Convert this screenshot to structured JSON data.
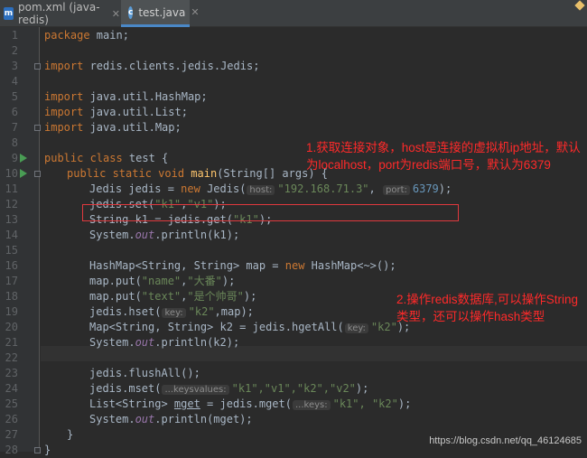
{
  "tabs": [
    {
      "label": "pom.xml (java-redis)",
      "icon": "maven-m-icon",
      "close": "✕"
    },
    {
      "label": "test.java",
      "icon": "go-class-icon",
      "close": "✕"
    }
  ],
  "line_numbers": [
    "1",
    "2",
    "3",
    "4",
    "5",
    "6",
    "7",
    "8",
    "9",
    "10",
    "11",
    "12",
    "13",
    "14",
    "15",
    "16",
    "17",
    "18",
    "19",
    "20",
    "21",
    "22",
    "23",
    "24",
    "25",
    "26",
    "27",
    "28"
  ],
  "code": {
    "l1_kw": "package",
    "l1_rest": " main;",
    "l3_kw": "import",
    "l3_rest": " redis.clients.jedis.Jedis;",
    "l5_kw": "import",
    "l5_rest": " java.util.HashMap;",
    "l6_kw": "import",
    "l6_rest": " java.util.List;",
    "l7_kw": "import",
    "l7_rest": " java.util.Map;",
    "l9_kw": "public class",
    "l9_rest": " test {",
    "l10_kw": "public static void",
    "l10_fn": "main",
    "l10_rest": "(String[] args) {",
    "l11_a": "Jedis jedis = ",
    "l11_new": "new",
    "l11_b": " Jedis(",
    "l11_hint1": "host:",
    "l11_str": "\"192.168.71.3\"",
    "l11_c": ", ",
    "l11_hint2": "port:",
    "l11_num": "6379",
    "l11_d": ");",
    "l12_a": "jedis.set(",
    "l12_s1": "\"k1\"",
    "l12_b": ",",
    "l12_s2": "\"v1\"",
    "l12_c": ");",
    "l13_a": "String k1 = jedis.get(",
    "l13_s1": "\"k1\"",
    "l13_b": ");",
    "l14_a": "System.",
    "l14_out": "out",
    "l14_b": ".println(k1);",
    "l16_a": "HashMap<String, String> map = ",
    "l16_new": "new",
    "l16_b": " HashMap<~>();",
    "l17_a": "map.put(",
    "l17_s1": "\"name\"",
    "l17_b": ",",
    "l17_s2": "\"大番\"",
    "l17_c": ");",
    "l18_a": "map.put(",
    "l18_s1": "\"text\"",
    "l18_b": ",",
    "l18_s2": "\"是个帅哥\"",
    "l18_c": ");",
    "l19_a": "jedis.hset(",
    "l19_hint": "key:",
    "l19_s1": "\"k2\"",
    "l19_b": ",map);",
    "l20_a": "Map<String, String> k2 = jedis.hgetAll(",
    "l20_hint": "key:",
    "l20_s1": "\"k2\"",
    "l20_b": ");",
    "l21_a": "System.",
    "l21_out": "out",
    "l21_b": ".println(k2);",
    "l23_a": "jedis.flushAll();",
    "l24_a": "jedis.mset(",
    "l24_hint": "...keysvalues:",
    "l24_s": "\"k1\",\"v1\",\"k2\",\"v2\"",
    "l24_b": ");",
    "l25_a": "List<String> ",
    "l25_var": "mget",
    "l25_b": " = jedis.mget(",
    "l25_hint": "...keys:",
    "l25_s": "\"k1\", \"k2\"",
    "l25_c": ");",
    "l26_a": "System.",
    "l26_out": "out",
    "l26_b": ".println(mget);",
    "l27_a": "}",
    "l28_a": "}"
  },
  "annotations": {
    "note1": "1.获取连接对象，host是连接的虚拟机ip地址，默认为localhost，port为redis端口号，默认为6379",
    "note2": "2.操作redis数据库,可以操作String类型，还可以操作hash类型"
  },
  "watermark": "https://blog.csdn.net/qq_46124685",
  "colors": {
    "keyword": "#cc7832",
    "string": "#6a8759",
    "number": "#6897bb",
    "method": "#ffc66d",
    "annotation": "#ff2a2a"
  }
}
